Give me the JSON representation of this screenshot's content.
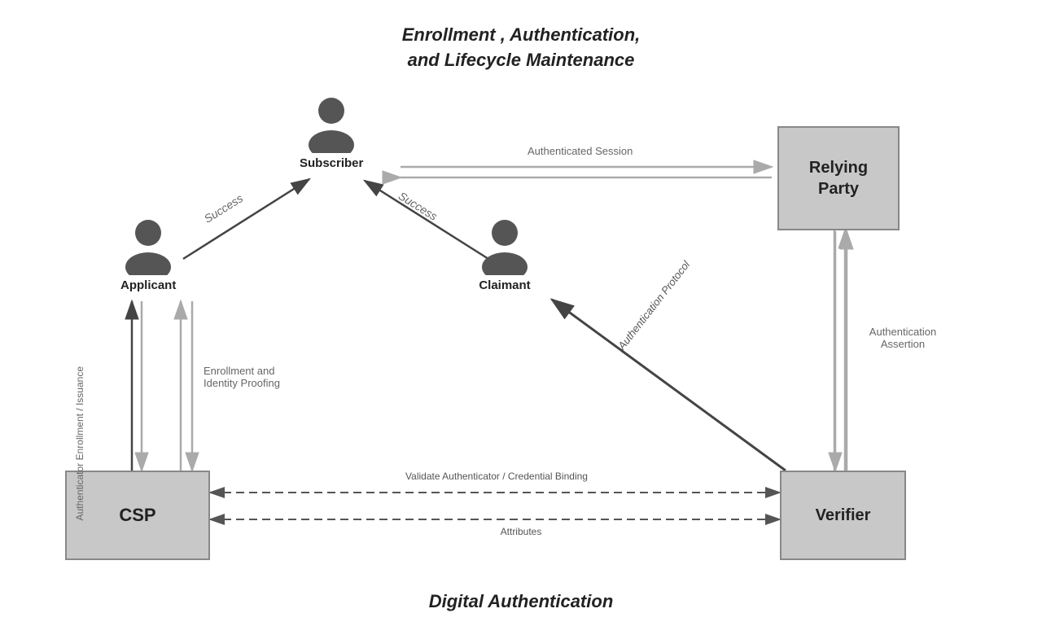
{
  "title_top_line1": "Enrollment ,  Authentication,",
  "title_top_line2": "and Lifecycle Maintenance",
  "title_bottom": "Digital Authentication",
  "nodes": {
    "subscriber": {
      "label": "Subscriber"
    },
    "applicant": {
      "label": "Applicant"
    },
    "claimant": {
      "label": "Claimant"
    },
    "csp": {
      "label": "CSP"
    },
    "verifier": {
      "label": "Verifier"
    },
    "relying_party": {
      "label": "Relying\nParty"
    }
  },
  "arrow_labels": {
    "success_applicant": "Success",
    "success_claimant": "Success",
    "authenticated_session": "Authenticated\nSession",
    "auth_protocol": "Authentication Protocol",
    "auth_assertion": "Authentication\nAssertion",
    "authenticator_enrollment": "Authenticator\nEnrollment /\nIssuance",
    "enrollment_identity": "Enrollment and\nIdentity Proofing",
    "validate_authenticator": "Validate Authenticator / Credential Binding",
    "attributes": "Attributes"
  }
}
